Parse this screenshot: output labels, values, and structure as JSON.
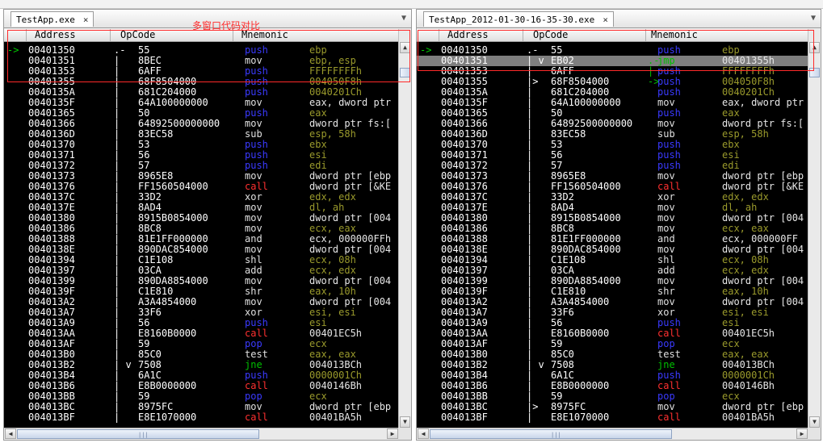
{
  "annotation": "多窗口代码对比",
  "columns": {
    "address": "Address",
    "opcode": "OpCode",
    "mnemonic": "Mnemonic"
  },
  "colors": {
    "push": "#3a3aff",
    "call": "#ff3030",
    "mov": "#e0e0e0",
    "register": "#9a9a2c",
    "operand": "#e6e6e6",
    "jump": "#00c000",
    "pointer": "#00d000",
    "selection": "#7f7f7f"
  },
  "panes": [
    {
      "tab": "TestApp.exe",
      "rows": [
        {
          "m": "->",
          "a": "00401350",
          "j": ".-",
          "o": "55",
          "n": "push",
          "p": "ebp"
        },
        {
          "a": "00401351",
          "j": "|",
          "o": "8BEC",
          "n": "mov",
          "p": "ebp, esp"
        },
        {
          "a": "00401353",
          "j": "|",
          "o": "6AFF",
          "n": "push",
          "p": "FFFFFFFFh"
        },
        {
          "a": "00401355",
          "j": "|",
          "o": "68F8504000",
          "n": "push",
          "p": "004050F8h"
        },
        {
          "a": "0040135A",
          "j": "|",
          "o": "681C204000",
          "n": "push",
          "p": "0040201Ch"
        },
        {
          "a": "0040135F",
          "j": "|",
          "o": "64A100000000",
          "n": "mov",
          "p": "eax, dword ptr"
        },
        {
          "a": "00401365",
          "j": "|",
          "o": "50",
          "n": "push",
          "p": "eax"
        },
        {
          "a": "00401366",
          "j": "|",
          "o": "64892500000000",
          "n": "mov",
          "p": "dword ptr fs:["
        },
        {
          "a": "0040136D",
          "j": "|",
          "o": "83EC58",
          "n": "sub",
          "p": "esp, 58h"
        },
        {
          "a": "00401370",
          "j": "|",
          "o": "53",
          "n": "push",
          "p": "ebx"
        },
        {
          "a": "00401371",
          "j": "|",
          "o": "56",
          "n": "push",
          "p": "esi"
        },
        {
          "a": "00401372",
          "j": "|",
          "o": "57",
          "n": "push",
          "p": "edi"
        },
        {
          "a": "00401373",
          "j": "|",
          "o": "8965E8",
          "n": "mov",
          "p": "dword ptr [ebp"
        },
        {
          "a": "00401376",
          "j": "|",
          "o": "FF1560504000",
          "n": "call",
          "p": "dword ptr [&KE"
        },
        {
          "a": "0040137C",
          "j": "|",
          "o": "33D2",
          "n": "xor",
          "p": "edx, edx"
        },
        {
          "a": "0040137E",
          "j": "|",
          "o": "8AD4",
          "n": "mov",
          "p": "dl, ah"
        },
        {
          "a": "00401380",
          "j": "|",
          "o": "8915B0854000",
          "n": "mov",
          "p": "dword ptr [004"
        },
        {
          "a": "00401386",
          "j": "|",
          "o": "8BC8",
          "n": "mov",
          "p": "ecx, eax"
        },
        {
          "a": "00401388",
          "j": "|",
          "o": "81E1FF000000",
          "n": "and",
          "p": "ecx, 000000FFh"
        },
        {
          "a": "0040138E",
          "j": "|",
          "o": "890DAC854000",
          "n": "mov",
          "p": "dword ptr [004"
        },
        {
          "a": "00401394",
          "j": "|",
          "o": "C1E108",
          "n": "shl",
          "p": "ecx, 08h"
        },
        {
          "a": "00401397",
          "j": "|",
          "o": "03CA",
          "n": "add",
          "p": "ecx, edx"
        },
        {
          "a": "00401399",
          "j": "|",
          "o": "890DA8854000",
          "n": "mov",
          "p": "dword ptr [004"
        },
        {
          "a": "0040139F",
          "j": "|",
          "o": "C1E810",
          "n": "shr",
          "p": "eax, 10h"
        },
        {
          "a": "004013A2",
          "j": "|",
          "o": "A3A4854000",
          "n": "mov",
          "p": "dword ptr [004"
        },
        {
          "a": "004013A7",
          "j": "|",
          "o": "33F6",
          "n": "xor",
          "p": "esi, esi"
        },
        {
          "a": "004013A9",
          "j": "|",
          "o": "56",
          "n": "push",
          "p": "esi"
        },
        {
          "a": "004013AA",
          "j": "|",
          "o": "E8160B0000",
          "n": "call",
          "p": "00401EC5h"
        },
        {
          "a": "004013AF",
          "j": "|",
          "o": "59",
          "n": "pop",
          "p": "ecx"
        },
        {
          "a": "004013B0",
          "j": "|",
          "o": "85C0",
          "n": "test",
          "p": "eax, eax"
        },
        {
          "a": "004013B2",
          "j": "| v",
          "o": "7508",
          "n": "jne",
          "p": "004013BCh"
        },
        {
          "a": "004013B4",
          "j": "|",
          "o": "6A1C",
          "n": "push",
          "p": "0000001Ch"
        },
        {
          "a": "004013B6",
          "j": "|",
          "o": "E8B0000000",
          "n": "call",
          "p": "0040146Bh"
        },
        {
          "a": "004013BB",
          "j": "|",
          "o": "59",
          "n": "pop",
          "p": "ecx"
        },
        {
          "a": "004013BC",
          "j": "|",
          "o": "8975FC",
          "n": "mov",
          "p": "dword ptr [ebp"
        },
        {
          "a": "004013BF",
          "j": "|",
          "o": "E8E1070000",
          "n": "call",
          "p": "00401BA5h"
        }
      ]
    },
    {
      "tab": "TestApp_2012-01-30-16-35-30.exe",
      "rows": [
        {
          "m": "->",
          "a": "00401350",
          "j": ".-",
          "o": "55",
          "n": "push",
          "p": "ebp"
        },
        {
          "a": "00401351",
          "j": "| v",
          "o": "EB02",
          "n": "jmp",
          "p": "00401355h",
          "sel": true,
          "ptr": ".-"
        },
        {
          "a": "00401353",
          "j": "|",
          "o": "6AFF",
          "n": "push",
          "p": "FFFFFFFFh",
          "ptr": "|"
        },
        {
          "a": "00401355",
          "j": "|>",
          "o": "68F8504000",
          "n": "push",
          "p": "004050F8h",
          "ptr": "->"
        },
        {
          "a": "0040135A",
          "j": "|",
          "o": "681C204000",
          "n": "push",
          "p": "0040201Ch"
        },
        {
          "a": "0040135F",
          "j": "|",
          "o": "64A100000000",
          "n": "mov",
          "p": "eax, dword ptr"
        },
        {
          "a": "00401365",
          "j": "|",
          "o": "50",
          "n": "push",
          "p": "eax"
        },
        {
          "a": "00401366",
          "j": "|",
          "o": "64892500000000",
          "n": "mov",
          "p": "dword ptr fs:["
        },
        {
          "a": "0040136D",
          "j": "|",
          "o": "83EC58",
          "n": "sub",
          "p": "esp, 58h"
        },
        {
          "a": "00401370",
          "j": "|",
          "o": "53",
          "n": "push",
          "p": "ebx"
        },
        {
          "a": "00401371",
          "j": "|",
          "o": "56",
          "n": "push",
          "p": "esi"
        },
        {
          "a": "00401372",
          "j": "|",
          "o": "57",
          "n": "push",
          "p": "edi"
        },
        {
          "a": "00401373",
          "j": "|",
          "o": "8965E8",
          "n": "mov",
          "p": "dword ptr [ebp"
        },
        {
          "a": "00401376",
          "j": "|",
          "o": "FF1560504000",
          "n": "call",
          "p": "dword ptr [&KE"
        },
        {
          "a": "0040137C",
          "j": "|",
          "o": "33D2",
          "n": "xor",
          "p": "edx, edx"
        },
        {
          "a": "0040137E",
          "j": "|",
          "o": "8AD4",
          "n": "mov",
          "p": "dl, ah"
        },
        {
          "a": "00401380",
          "j": "|",
          "o": "8915B0854000",
          "n": "mov",
          "p": "dword ptr [004"
        },
        {
          "a": "00401386",
          "j": "|",
          "o": "8BC8",
          "n": "mov",
          "p": "ecx, eax"
        },
        {
          "a": "00401388",
          "j": "|",
          "o": "81E1FF000000",
          "n": "and",
          "p": "ecx, 000000FF"
        },
        {
          "a": "0040138E",
          "j": "|",
          "o": "890DAC854000",
          "n": "mov",
          "p": "dword ptr [004"
        },
        {
          "a": "00401394",
          "j": "|",
          "o": "C1E108",
          "n": "shl",
          "p": "ecx, 08h"
        },
        {
          "a": "00401397",
          "j": "|",
          "o": "03CA",
          "n": "add",
          "p": "ecx, edx"
        },
        {
          "a": "00401399",
          "j": "|",
          "o": "890DA8854000",
          "n": "mov",
          "p": "dword ptr [004"
        },
        {
          "a": "0040139F",
          "j": "|",
          "o": "C1E810",
          "n": "shr",
          "p": "eax, 10h"
        },
        {
          "a": "004013A2",
          "j": "|",
          "o": "A3A4854000",
          "n": "mov",
          "p": "dword ptr [004"
        },
        {
          "a": "004013A7",
          "j": "|",
          "o": "33F6",
          "n": "xor",
          "p": "esi, esi"
        },
        {
          "a": "004013A9",
          "j": "|",
          "o": "56",
          "n": "push",
          "p": "esi"
        },
        {
          "a": "004013AA",
          "j": "|",
          "o": "E8160B0000",
          "n": "call",
          "p": "00401EC5h"
        },
        {
          "a": "004013AF",
          "j": "|",
          "o": "59",
          "n": "pop",
          "p": "ecx"
        },
        {
          "a": "004013B0",
          "j": "|",
          "o": "85C0",
          "n": "test",
          "p": "eax, eax"
        },
        {
          "a": "004013B2",
          "j": "| v",
          "o": "7508",
          "n": "jne",
          "p": "004013BCh"
        },
        {
          "a": "004013B4",
          "j": "|",
          "o": "6A1C",
          "n": "push",
          "p": "0000001Ch"
        },
        {
          "a": "004013B6",
          "j": "|",
          "o": "E8B0000000",
          "n": "call",
          "p": "0040146Bh"
        },
        {
          "a": "004013BB",
          "j": "|",
          "o": "59",
          "n": "pop",
          "p": "ecx"
        },
        {
          "a": "004013BC",
          "j": "|>",
          "o": "8975FC",
          "n": "mov",
          "p": "dword ptr [ebp"
        },
        {
          "a": "004013BF",
          "j": "|",
          "o": "E8E1070000",
          "n": "call",
          "p": "00401BA5h"
        }
      ]
    }
  ]
}
